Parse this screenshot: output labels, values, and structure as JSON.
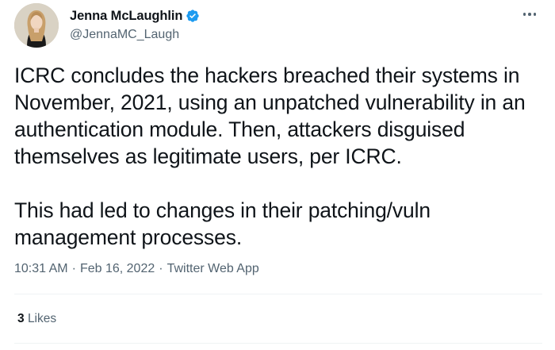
{
  "author": {
    "display_name": "Jenna McLaughlin",
    "handle": "@JennaMC_Laugh",
    "verified": true,
    "verified_color": "#1d9bf0"
  },
  "tweet": {
    "paragraphs": [
      "ICRC concludes the hackers breached their systems in November, 2021, using an unpatched vulnerability in an authentication module. Then, attackers disguised themselves as legitimate users, per ICRC.",
      "This had led to changes in their patching/vuln management processes."
    ]
  },
  "meta": {
    "time": "10:31 AM",
    "separator": "·",
    "date": "Feb 16, 2022",
    "source": "Twitter Web App"
  },
  "stats": {
    "likes_count": "3",
    "likes_label": "Likes"
  },
  "icons": {
    "more": "more-horizontal-icon",
    "verified": "verified-badge-icon"
  }
}
